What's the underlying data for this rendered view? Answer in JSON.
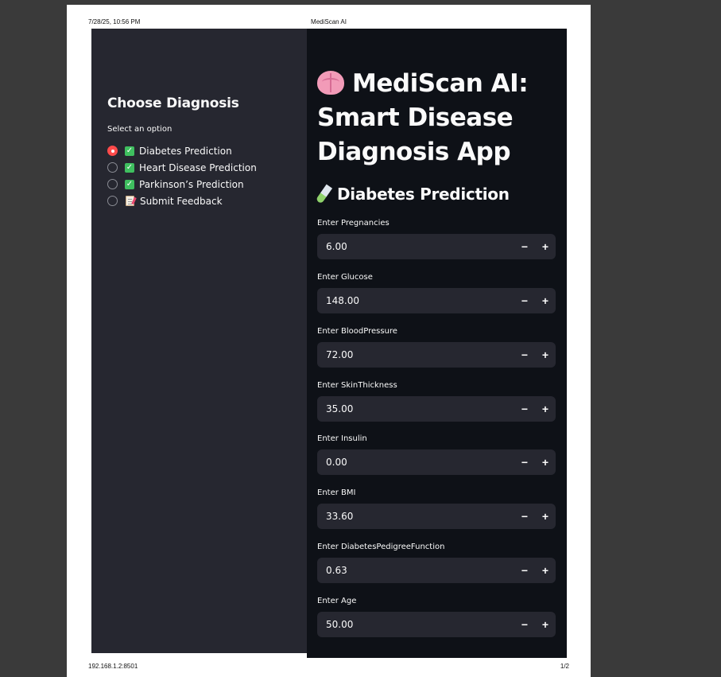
{
  "print": {
    "datetime": "7/28/25, 10:56 PM",
    "page_title": "MediScan AI",
    "url": "192.168.1.2:8501",
    "page_number": "1/2"
  },
  "sidebar": {
    "title": "Choose Diagnosis",
    "radio_label": "Select an option",
    "options": [
      {
        "label": "Diabetes Prediction",
        "icon": "check-mark-icon",
        "selected": true
      },
      {
        "label": "Heart Disease Prediction",
        "icon": "check-mark-icon",
        "selected": false
      },
      {
        "label": "Parkinson’s Prediction",
        "icon": "check-mark-icon",
        "selected": false
      },
      {
        "label": "Submit Feedback",
        "icon": "memo-icon",
        "selected": false
      }
    ]
  },
  "main": {
    "title": "MediScan AI: Smart Disease Diagnosis App",
    "title_icon": "brain-icon",
    "section_title": "Diabetes Prediction",
    "section_icon": "test-tube-icon",
    "fields": [
      {
        "label": "Enter Pregnancies",
        "value": "6.00"
      },
      {
        "label": "Enter Glucose",
        "value": "148.00"
      },
      {
        "label": "Enter BloodPressure",
        "value": "72.00"
      },
      {
        "label": "Enter SkinThickness",
        "value": "35.00"
      },
      {
        "label": "Enter Insulin",
        "value": "0.00"
      },
      {
        "label": "Enter BMI",
        "value": "33.60"
      },
      {
        "label": "Enter DiabetesPedigreeFunction",
        "value": "0.63"
      },
      {
        "label": "Enter Age",
        "value": "50.00"
      }
    ],
    "decrement_symbol": "−",
    "increment_symbol": "+"
  },
  "colors": {
    "sidebar_bg": "#262730",
    "main_bg": "#0e1117",
    "accent": "#ff4b4b",
    "input_bg": "#262730"
  }
}
